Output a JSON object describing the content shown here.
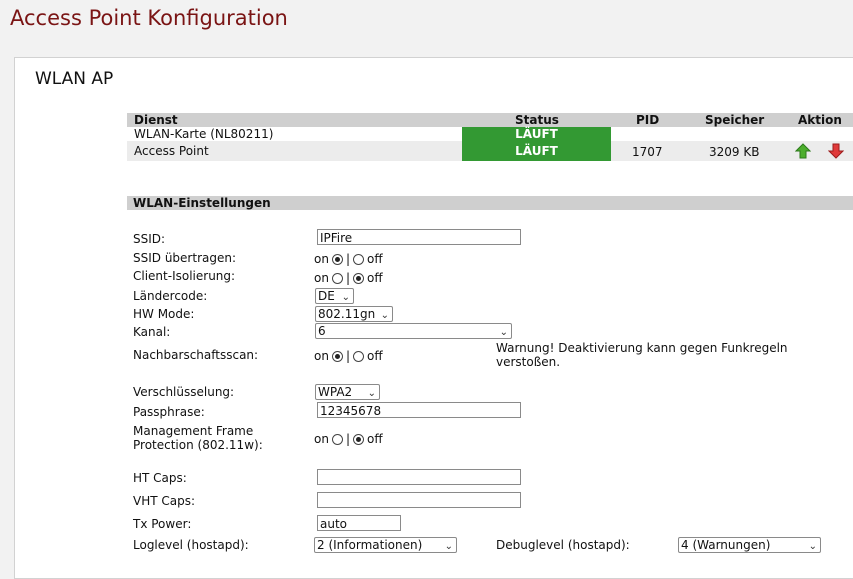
{
  "page": {
    "title": "Access Point Konfiguration"
  },
  "section": {
    "title": "WLAN AP"
  },
  "services": {
    "headers": {
      "service": "Dienst",
      "status": "Status",
      "pid": "PID",
      "memory": "Speicher",
      "action": "Aktion"
    },
    "rows": [
      {
        "name": "WLAN-Karte (NL80211)",
        "status": "LÄUFT",
        "pid": "",
        "memory": ""
      },
      {
        "name": "Access Point",
        "status": "LÄUFT",
        "pid": "1707",
        "memory": "3209 KB"
      }
    ],
    "status_color": "#339933",
    "icons": {
      "start": "up-arrow-green-icon",
      "stop": "down-arrow-red-icon"
    }
  },
  "settings": {
    "title": "WLAN-Einstellungen",
    "on_label": "on",
    "off_label": "off",
    "separator": "|",
    "ssid": {
      "label": "SSID:",
      "value": "IPFire"
    },
    "ssid_broadcast": {
      "label": "SSID übertragen:",
      "selected": "on"
    },
    "client_isolation": {
      "label": "Client-Isolierung:",
      "selected": "off"
    },
    "country": {
      "label": "Ländercode:",
      "value": "DE"
    },
    "hw_mode": {
      "label": "HW Mode:",
      "value": "802.11gn"
    },
    "channel": {
      "label": "Kanal:",
      "value": "6"
    },
    "neighbor_scan": {
      "label": "Nachbarschaftsscan:",
      "selected": "on",
      "warning_line1": "Warnung! Deaktivierung kann gegen Funkregeln",
      "warning_line2": "verstoßen."
    },
    "encryption": {
      "label": "Verschlüsselung:",
      "value": "WPA2"
    },
    "passphrase": {
      "label": "Passphrase:",
      "value": "12345678"
    },
    "mfp": {
      "label_line1": "Management Frame",
      "label_line2": "Protection (802.11w):",
      "selected": "off"
    },
    "ht_caps": {
      "label": "HT Caps:",
      "value": ""
    },
    "vht_caps": {
      "label": "VHT Caps:",
      "value": ""
    },
    "tx_power": {
      "label": "Tx Power:",
      "value": "auto"
    },
    "loglevel": {
      "label": "Loglevel (hostapd):",
      "value": "2 (Informationen)"
    },
    "debuglevel": {
      "label": "Debuglevel (hostapd):",
      "value": "4 (Warnungen)"
    }
  }
}
